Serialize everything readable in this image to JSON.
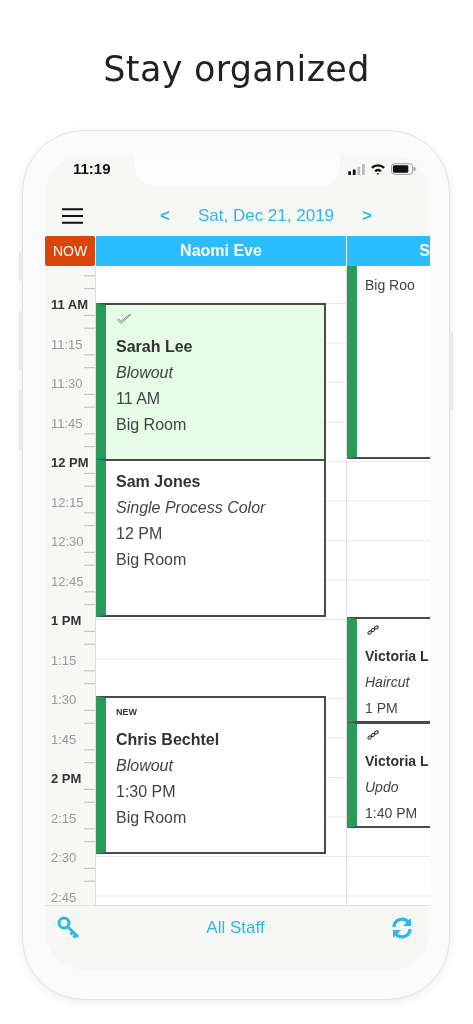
{
  "heading": "Stay organized",
  "status_bar": {
    "time": "11:19"
  },
  "nav": {
    "prev": "<",
    "date": "Sat, Dec 21, 2019",
    "next": ">"
  },
  "now_button": "NOW",
  "time_labels": [
    {
      "label": "11 AM",
      "kind": "hour"
    },
    {
      "label": "11:15",
      "kind": "quarter"
    },
    {
      "label": "11:30",
      "kind": "quarter"
    },
    {
      "label": "11:45",
      "kind": "quarter"
    },
    {
      "label": "12 PM",
      "kind": "hour"
    },
    {
      "label": "12:15",
      "kind": "quarter"
    },
    {
      "label": "12:30",
      "kind": "quarter"
    },
    {
      "label": "12:45",
      "kind": "quarter"
    },
    {
      "label": "1 PM",
      "kind": "hour"
    },
    {
      "label": "1:15",
      "kind": "quarter"
    },
    {
      "label": "1:30",
      "kind": "quarter"
    },
    {
      "label": "1:45",
      "kind": "quarter"
    },
    {
      "label": "2 PM",
      "kind": "hour"
    },
    {
      "label": "2:15",
      "kind": "quarter"
    },
    {
      "label": "2:30",
      "kind": "quarter"
    },
    {
      "label": "2:45",
      "kind": "quarter"
    }
  ],
  "staff_columns": [
    {
      "name": "Naomi Eve",
      "appointments": [
        {
          "client": "Sarah Lee",
          "service": "Blowout",
          "time": "11 AM",
          "room": "Big Room",
          "confirmed": true,
          "linked": false
        },
        {
          "client": "Sam Jones",
          "service": "Single Process Color",
          "time": "12 PM",
          "room": "Big Room",
          "confirmed": false,
          "linked": false
        },
        {
          "badge": "NEW",
          "client": "Chris Bechtel",
          "service": "Blowout",
          "time": "1:30 PM",
          "room": "Big Room",
          "confirmed": false,
          "linked": false
        }
      ]
    },
    {
      "name": "S",
      "appointments": [
        {
          "room": "Big Roo",
          "confirmed": false,
          "linked": false
        },
        {
          "client": "Victoria L",
          "service": "Haircut",
          "time": "1 PM",
          "confirmed": false,
          "linked": true
        },
        {
          "client": "Victoria L",
          "service": "Updo",
          "time": "1:40 PM",
          "confirmed": false,
          "linked": true
        }
      ]
    }
  ],
  "footer": {
    "filter": "All Staff"
  }
}
